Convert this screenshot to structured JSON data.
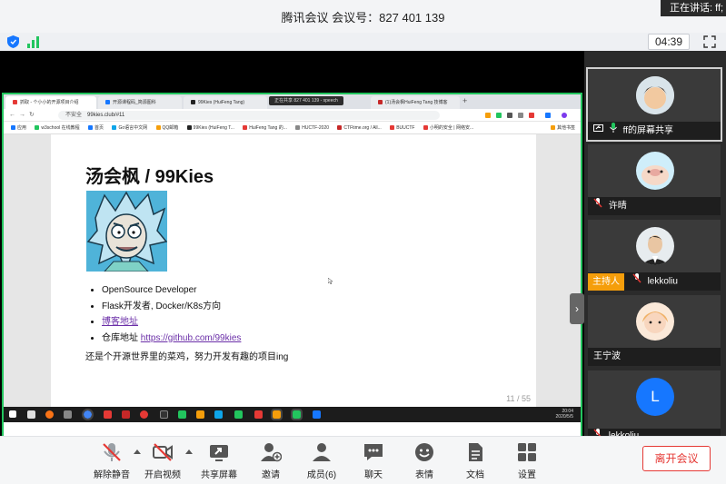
{
  "window": {
    "title": "腾讯会议 会议号：827 401 139",
    "speaking": "正在讲话: ff;"
  },
  "status": {
    "timer": "04:39"
  },
  "shared_screen": {
    "browser": {
      "tabs": [
        "抓取 - 个小小的开源项目介绍",
        "开源课程码_简源图科",
        "99Kies (HuiFeng Tang)",
        "(1)汤会枫HuiFeng Tang 技博客"
      ],
      "sharing_pill": "正在共享 827 401 139 - speech",
      "address_insecure": "不安全",
      "address_url": "99kies.club/#11",
      "bookmarks": [
        "应用",
        "w3school 在线教程",
        "首页",
        "Go语言中文网",
        "QQ邮箱",
        "99Kies (HuiFeng T...",
        "HuiFeng Tang 的...",
        "HUCTF-2020",
        "CTFtime.org / All...",
        "BUUCTF",
        "小明的安全 | 网络安..."
      ],
      "bookmarks_other": "其他书签"
    },
    "slide": {
      "title": "汤会枫 / 99Kies",
      "bullets": {
        "b1": "OpenSource Developer",
        "b2": "Flask开发者, Docker/K8s方向",
        "b3": "博客地址",
        "b4_label": "仓库地址 ",
        "b4_link": "https://github.com/99kies"
      },
      "tagline": "还是个开源世界里的菜鸡，努力开发有趣的项目ing",
      "page": "11 / 55"
    },
    "taskbar": {
      "time": "20:04",
      "date": "2020/5/5"
    }
  },
  "participants": [
    {
      "name": "ff的屏幕共享",
      "sharing": true
    },
    {
      "name": "许晴"
    },
    {
      "name": "lekkoliu",
      "badge": "主持人"
    },
    {
      "name": "王宁波"
    },
    {
      "name": "lekkoliu...",
      "initial": "L"
    }
  ],
  "toolbar": {
    "unmute": "解除静音",
    "start_video": "开启视频",
    "share_screen": "共享屏幕",
    "invite": "邀请",
    "members": "成员(6)",
    "chat": "聊天",
    "reactions": "表情",
    "docs": "文档",
    "settings": "设置",
    "leave": "离开会议"
  },
  "colors": {
    "share_border": "#22c55e",
    "host_badge": "#f59e0b",
    "leave": "#e53935",
    "signal": "#22c55e",
    "avatar_letter_bg": "#1677ff"
  }
}
